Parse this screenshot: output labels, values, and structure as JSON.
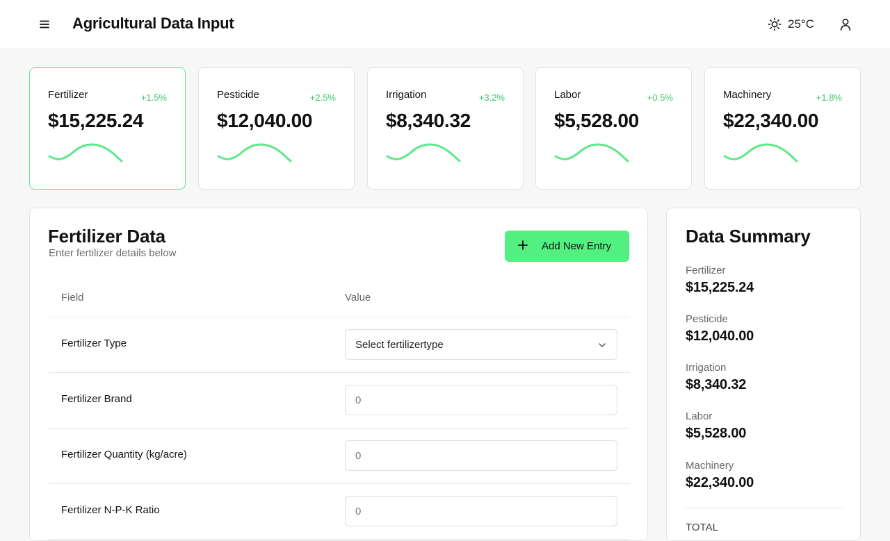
{
  "header": {
    "title": "Agricultural Data Input",
    "temperature": "25°C",
    "icons": [
      "menu-icon",
      "sun-icon",
      "user-icon"
    ]
  },
  "colors": {
    "accent": "#52f080",
    "positive": "#3ec96b",
    "sparkline": "#5ee88a"
  },
  "metrics": [
    {
      "label": "Fertilizer",
      "change": "+1.5%",
      "value": "$15,225.24",
      "active": true
    },
    {
      "label": "Pesticide",
      "change": "+2.5%",
      "value": "$12,040.00",
      "active": false
    },
    {
      "label": "Irrigation",
      "change": "+3.2%",
      "value": "$8,340.32",
      "active": false
    },
    {
      "label": "Labor",
      "change": "+0.5%",
      "value": "$5,528.00",
      "active": false
    },
    {
      "label": "Machinery",
      "change": "+1.8%",
      "value": "$22,340.00",
      "active": false
    }
  ],
  "form": {
    "title": "Fertilizer Data",
    "subtitle": "Enter fertilizer details below",
    "add_button": "Add New Entry",
    "columns": [
      "Field",
      "Value"
    ],
    "rows": [
      {
        "label": "Fertilizer Type",
        "kind": "select",
        "value": "Select fertilizertype"
      },
      {
        "label": "Fertilizer Brand",
        "kind": "input",
        "placeholder": "0"
      },
      {
        "label": "Fertilizer Quantity (kg/acre)",
        "kind": "input",
        "placeholder": "0"
      },
      {
        "label": "Fertilizer N-P-K Ratio",
        "kind": "input",
        "placeholder": "0"
      }
    ]
  },
  "summary": {
    "title": "Data Summary",
    "items": [
      {
        "label": "Fertilizer",
        "value": "$15,225.24"
      },
      {
        "label": "Pesticide",
        "value": "$12,040.00"
      },
      {
        "label": "Irrigation",
        "value": "$8,340.32"
      },
      {
        "label": "Labor",
        "value": "$5,528.00"
      },
      {
        "label": "Machinery",
        "value": "$22,340.00"
      }
    ],
    "total_label": "TOTAL"
  }
}
